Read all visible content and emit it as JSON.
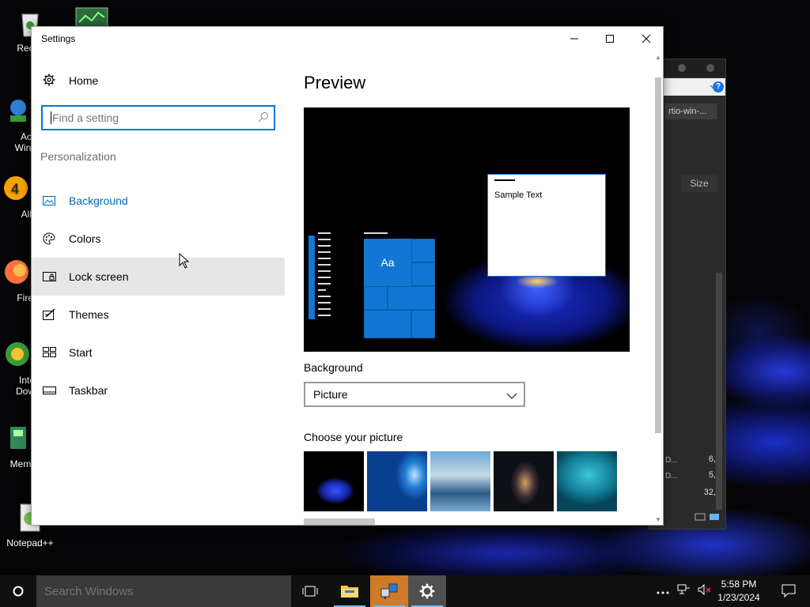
{
  "desktop": {
    "icons": [
      {
        "name": "recycle-bin",
        "label": "Recyc"
      },
      {
        "name": "active-window",
        "label": "Acti\nWind"
      },
      {
        "name": "aimp",
        "label": "All"
      },
      {
        "name": "firefox",
        "label": "Fire"
      },
      {
        "name": "internet-download",
        "label": "Inte\nDow"
      },
      {
        "name": "mem",
        "label": "Mem I"
      },
      {
        "name": "notepadpp",
        "label": "Notepad++"
      }
    ]
  },
  "bg_window": {
    "chip": "rtio-win-...",
    "col_header": "Size",
    "numbers": [
      "6,",
      "5,",
      "32,"
    ],
    "small_cells": [
      "D...",
      "D..."
    ],
    "help": "?"
  },
  "settings": {
    "title": "Settings",
    "home_label": "Home",
    "search_placeholder": "Find a setting",
    "section": "Personalization",
    "nav": [
      {
        "label": "Background",
        "icon": "picture-icon",
        "state": "active"
      },
      {
        "label": "Colors",
        "icon": "palette-icon",
        "state": "normal"
      },
      {
        "label": "Lock screen",
        "icon": "lock-screen-icon",
        "state": "hover"
      },
      {
        "label": "Themes",
        "icon": "themes-icon",
        "state": "normal"
      },
      {
        "label": "Start",
        "icon": "start-icon",
        "state": "normal"
      },
      {
        "label": "Taskbar",
        "icon": "taskbar-icon",
        "state": "normal"
      }
    ],
    "preview_heading": "Preview",
    "preview_tile_text": "Aa",
    "preview_sample_text": "Sample Text",
    "background_label": "Background",
    "background_value": "Picture",
    "choose_label": "Choose your picture",
    "thumbnails": [
      "blue-flower",
      "windows-10",
      "beach-rocks",
      "night-sky",
      "underwater"
    ]
  },
  "taskbar": {
    "search_placeholder": "Search Windows",
    "time": "5:58 PM",
    "date": "1/23/2024",
    "pinned": [
      "task-view",
      "file-explorer",
      "network-app",
      "settings"
    ]
  },
  "colors": {
    "accent": "#0078d7",
    "active_text": "#0067b8",
    "hover_bg": "#e6e6e6",
    "taskbar": "#101010",
    "running_app": "#cf7a28"
  }
}
